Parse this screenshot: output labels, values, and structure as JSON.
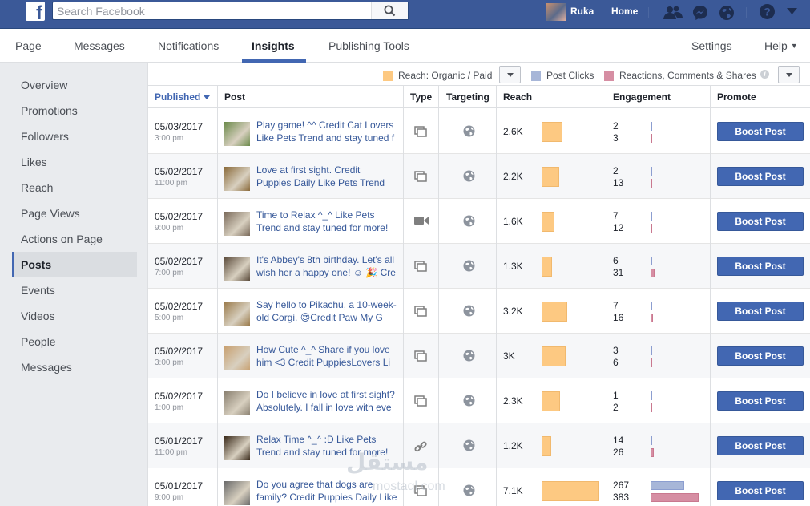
{
  "topbar": {
    "logo": "f",
    "search_placeholder": "Search Facebook",
    "profile_name": "Ruka",
    "home_label": "Home",
    "icons": [
      "friends-icon",
      "messenger-icon",
      "globe-icon",
      "help-icon",
      "caret-down-icon"
    ]
  },
  "tabs": {
    "page": "Page",
    "messages": "Messages",
    "notifications": "Notifications",
    "insights": "Insights",
    "publishing_tools": "Publishing Tools",
    "settings": "Settings",
    "help": "Help"
  },
  "sidebar": {
    "items": [
      "Overview",
      "Promotions",
      "Followers",
      "Likes",
      "Reach",
      "Page Views",
      "Actions on Page",
      "Posts",
      "Events",
      "Videos",
      "People",
      "Messages"
    ],
    "active": "Posts"
  },
  "legend": {
    "reach": "Reach: Organic / Paid",
    "post_clicks": "Post Clicks",
    "reactions": "Reactions, Comments & Shares"
  },
  "colors": {
    "brand": "#3b5998",
    "accent": "#4267b2",
    "reach_bar": "#fdc982",
    "clicks_bar": "#a7b6d8",
    "reactions_bar": "#d68ea3"
  },
  "table": {
    "headers": {
      "published": "Published",
      "post": "Post",
      "type": "Type",
      "targeting": "Targeting",
      "reach": "Reach",
      "engagement": "Engagement",
      "promote": "Promote"
    },
    "boost_label": "Boost Post",
    "max_reach": 7100,
    "max_engagement": 383,
    "rows": [
      {
        "date": "05/03/2017",
        "time": "3:00 pm",
        "post": "Play game! ^^ Credit Cat Lovers Like Pets Trend and stay tuned f",
        "type": "album",
        "reach": "2.6K",
        "reach_value": 2600,
        "clicks": "2",
        "reactions": "3",
        "thumb": "#6b8a4a"
      },
      {
        "date": "05/02/2017",
        "time": "11:00 pm",
        "post": "Love at first sight. Credit Puppies Daily Like Pets Trend and stay",
        "type": "album",
        "reach": "2.2K",
        "reach_value": 2200,
        "clicks": "2",
        "reactions": "13",
        "thumb": "#8a6a3a"
      },
      {
        "date": "05/02/2017",
        "time": "9:00 pm",
        "post": "Time to Relax ^_^ Like Pets Trend and stay tuned for more!",
        "type": "video",
        "reach": "1.6K",
        "reach_value": 1600,
        "clicks": "7",
        "reactions": "12",
        "thumb": "#7a6a5a"
      },
      {
        "date": "05/02/2017",
        "time": "7:00 pm",
        "post": "It's Abbey's 8th birthday. Let's all wish her a happy one! ☺ 🎉 Cre",
        "type": "album",
        "reach": "1.3K",
        "reach_value": 1300,
        "clicks": "6",
        "reactions": "31",
        "thumb": "#5a4a3a"
      },
      {
        "date": "05/02/2017",
        "time": "5:00 pm",
        "post": "Say hello to Pikachu, a 10-week-old Corgi. 😍Credit Paw My G",
        "type": "album",
        "reach": "3.2K",
        "reach_value": 3200,
        "clicks": "7",
        "reactions": "16",
        "thumb": "#9a7a4a"
      },
      {
        "date": "05/02/2017",
        "time": "3:00 pm",
        "post": "How Cute ^_^ Share if you love him <3 Credit PuppiesLovers Li",
        "type": "album",
        "reach": "3K",
        "reach_value": 3000,
        "clicks": "3",
        "reactions": "6",
        "thumb": "#c8a070"
      },
      {
        "date": "05/02/2017",
        "time": "1:00 pm",
        "post": "Do I believe in love at first sight? Absolutely. I fall in love with eve",
        "type": "album",
        "reach": "2.3K",
        "reach_value": 2300,
        "clicks": "1",
        "reactions": "2",
        "thumb": "#8a8070"
      },
      {
        "date": "05/01/2017",
        "time": "11:00 pm",
        "post": "Relax Time ^_^ :D Like Pets Trend and stay tuned for more!",
        "type": "link",
        "reach": "1.2K",
        "reach_value": 1200,
        "clicks": "14",
        "reactions": "26",
        "thumb": "#3a2a1a"
      },
      {
        "date": "05/01/2017",
        "time": "9:00 pm",
        "post": "Do you agree that dogs are family? Credit Puppies Daily Like Pe",
        "type": "album",
        "reach": "7.1K",
        "reach_value": 7100,
        "clicks": "267",
        "reactions": "383",
        "thumb": "#6a6a6a"
      }
    ]
  },
  "watermark": {
    "main": "مستقل",
    "sub": "mostaql.com"
  }
}
